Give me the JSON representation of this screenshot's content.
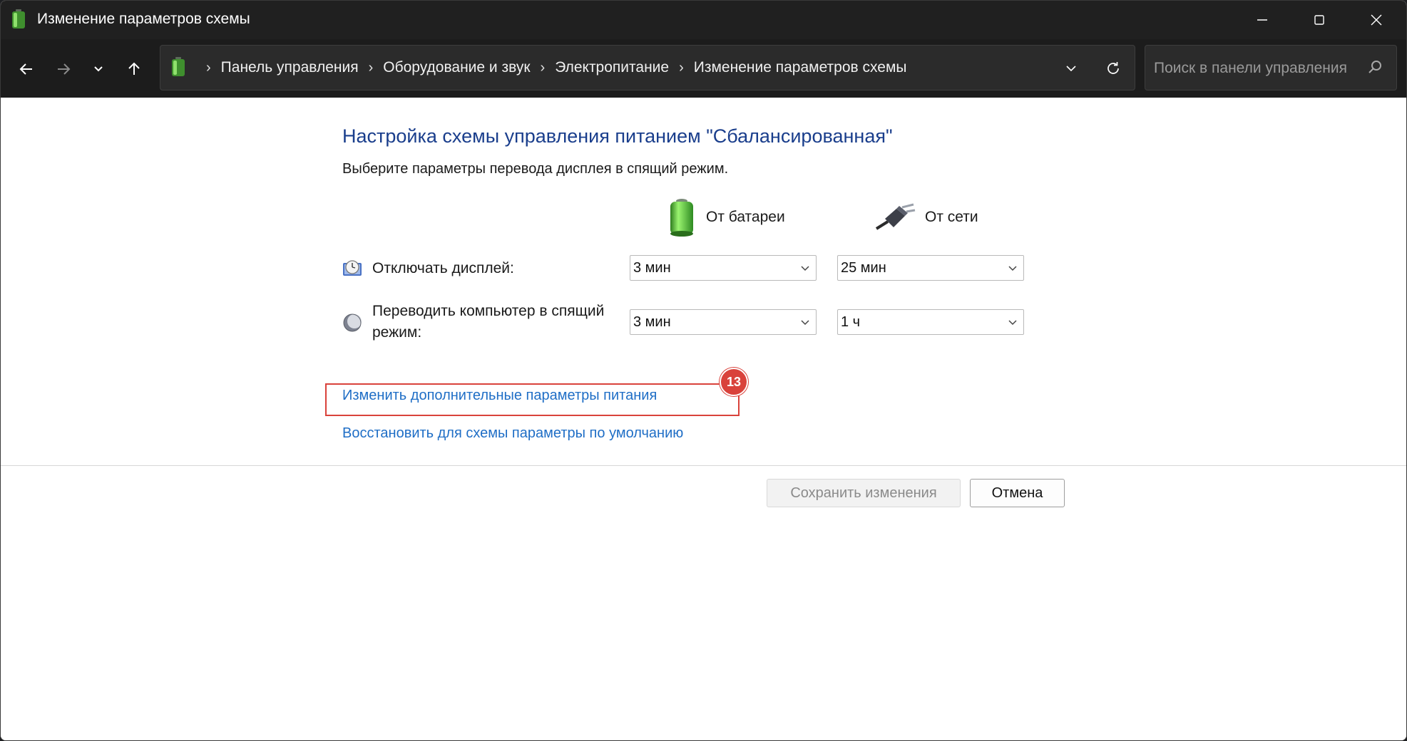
{
  "window": {
    "title": "Изменение параметров схемы"
  },
  "breadcrumbs": [
    "Панель управления",
    "Оборудование и звук",
    "Электропитание",
    "Изменение параметров схемы"
  ],
  "search": {
    "placeholder": "Поиск в панели управления"
  },
  "main": {
    "heading": "Настройка схемы управления питанием \"Сбалансированная\"",
    "subheading": "Выберите параметры перевода дисплея в спящий режим.",
    "columns": {
      "battery": "От батареи",
      "power": "От сети"
    },
    "rows": [
      {
        "label": "Отключать дисплей:",
        "battery": "3 мин",
        "power": "25 мин"
      },
      {
        "label_line1": "Переводить компьютер в спящий",
        "label_line2": "режим:",
        "battery": "3 мин",
        "power": "1 ч"
      }
    ],
    "links": {
      "advanced": "Изменить дополнительные параметры питания",
      "restore": "Восстановить для схемы параметры по умолчанию"
    },
    "annotation_badge": "13",
    "buttons": {
      "save": "Сохранить изменения",
      "cancel": "Отмена"
    }
  },
  "icons": {
    "app": "battery-icon",
    "back": "arrow-left-icon",
    "forward": "arrow-right-icon",
    "recent": "chevron-down-icon",
    "up": "arrow-up-icon",
    "refresh": "refresh-icon",
    "search": "search-icon",
    "display": "display-clock-icon",
    "sleep": "moon-icon",
    "plug": "plug-icon"
  },
  "colors": {
    "heading": "#1a3e8c",
    "link": "#1f6ec6",
    "highlight": "#d9423b",
    "titlebar": "#202020"
  }
}
